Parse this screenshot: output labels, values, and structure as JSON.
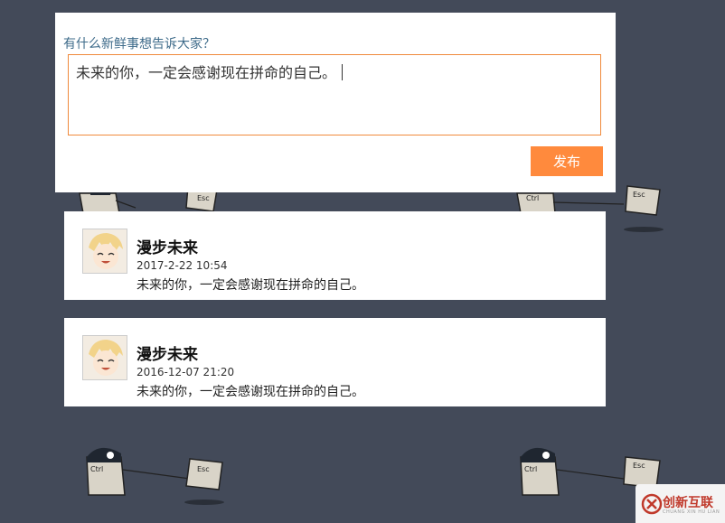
{
  "composer": {
    "prompt": "有什么新鲜事想告诉大家？",
    "input_value": "未来的你，一定会感谢现在拼命的自己。",
    "publish_label": "发布"
  },
  "posts": [
    {
      "author": "漫步未来",
      "timestamp": "2017-2-22 10:54",
      "content": "未来的你，一定会感谢现在拼命的自己。"
    },
    {
      "author": "漫步未来",
      "timestamp": "2016-12-07 21:20",
      "content": "未来的你，一定会感谢现在拼命的自己。"
    }
  ],
  "background": {
    "key_labels": [
      "Ctrl",
      "Esc"
    ]
  },
  "watermark": {
    "name": "创新互联",
    "sub": "CHUANG XIN HU LIAN"
  },
  "colors": {
    "page_bg": "#434a59",
    "accent": "#ff8a3d",
    "input_border": "#f08a3c",
    "prompt_text": "#3e6b8a"
  }
}
